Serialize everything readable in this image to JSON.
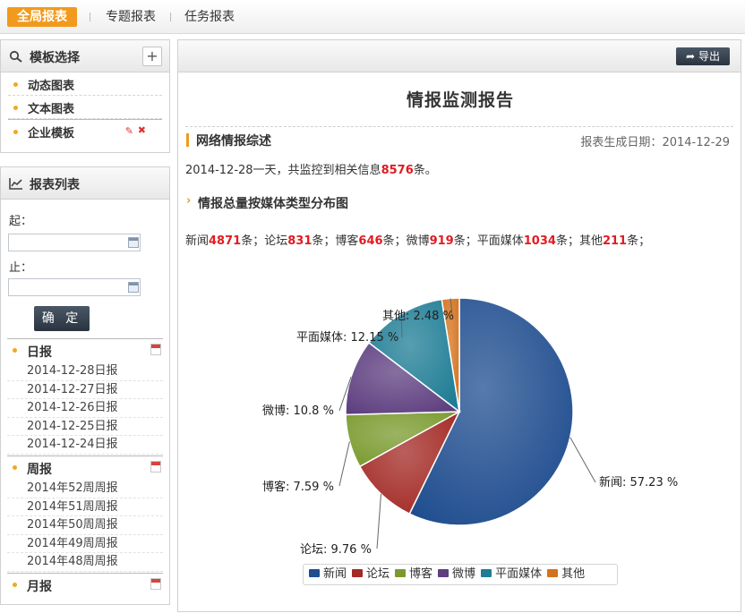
{
  "topnav": {
    "active": "全局报表",
    "items": [
      "专题报表",
      "任务报表"
    ]
  },
  "templates": {
    "title": "模板选择",
    "add": "+",
    "items": [
      "动态图表",
      "文本图表",
      "企业模板"
    ]
  },
  "reportlist": {
    "title": "报表列表",
    "start_label": "起：",
    "end_label": "止：",
    "start_value": "",
    "end_value": "",
    "ok": "确 定",
    "daily": {
      "label": "日报",
      "items": [
        "2014-12-28日报",
        "2014-12-27日报",
        "2014-12-26日报",
        "2014-12-25日报",
        "2014-12-24日报"
      ]
    },
    "weekly": {
      "label": "周报",
      "items": [
        "2014年52周周报",
        "2014年51周周报",
        "2014年50周周报",
        "2014年49周周报",
        "2014年48周周报"
      ]
    },
    "monthly": {
      "label": "月报"
    }
  },
  "report": {
    "export": "导出",
    "title": "情报监测报告",
    "section1": "网络情报综述",
    "gen_date_label": "报表生成日期：",
    "gen_date": "2014-12-29",
    "summary_pre": "2014-12-28一天，共监控到相关信息",
    "summary_count": "8576",
    "summary_post": "条。",
    "section2": "情报总量按媒体类型分布图",
    "unit": "条",
    "sep": "；"
  },
  "chart_data": {
    "type": "pie",
    "title": "",
    "categories": [
      "新闻",
      "论坛",
      "博客",
      "微博",
      "平面媒体",
      "其他"
    ],
    "counts": [
      4871,
      831,
      646,
      919,
      1034,
      211
    ],
    "values": [
      57.23,
      9.76,
      7.59,
      10.8,
      12.15,
      2.48
    ],
    "labels": [
      "新闻: 57.23 %",
      "论坛: 9.76 %",
      "博客: 7.59 %",
      "微博: 10.8 %",
      "平面媒体: 12.15 %",
      "其他: 2.48 %"
    ],
    "colors": [
      "#1f4d8f",
      "#a32a25",
      "#7a9a2e",
      "#5e3f80",
      "#1f7d95",
      "#d4731d"
    ],
    "legend": "bottom"
  }
}
